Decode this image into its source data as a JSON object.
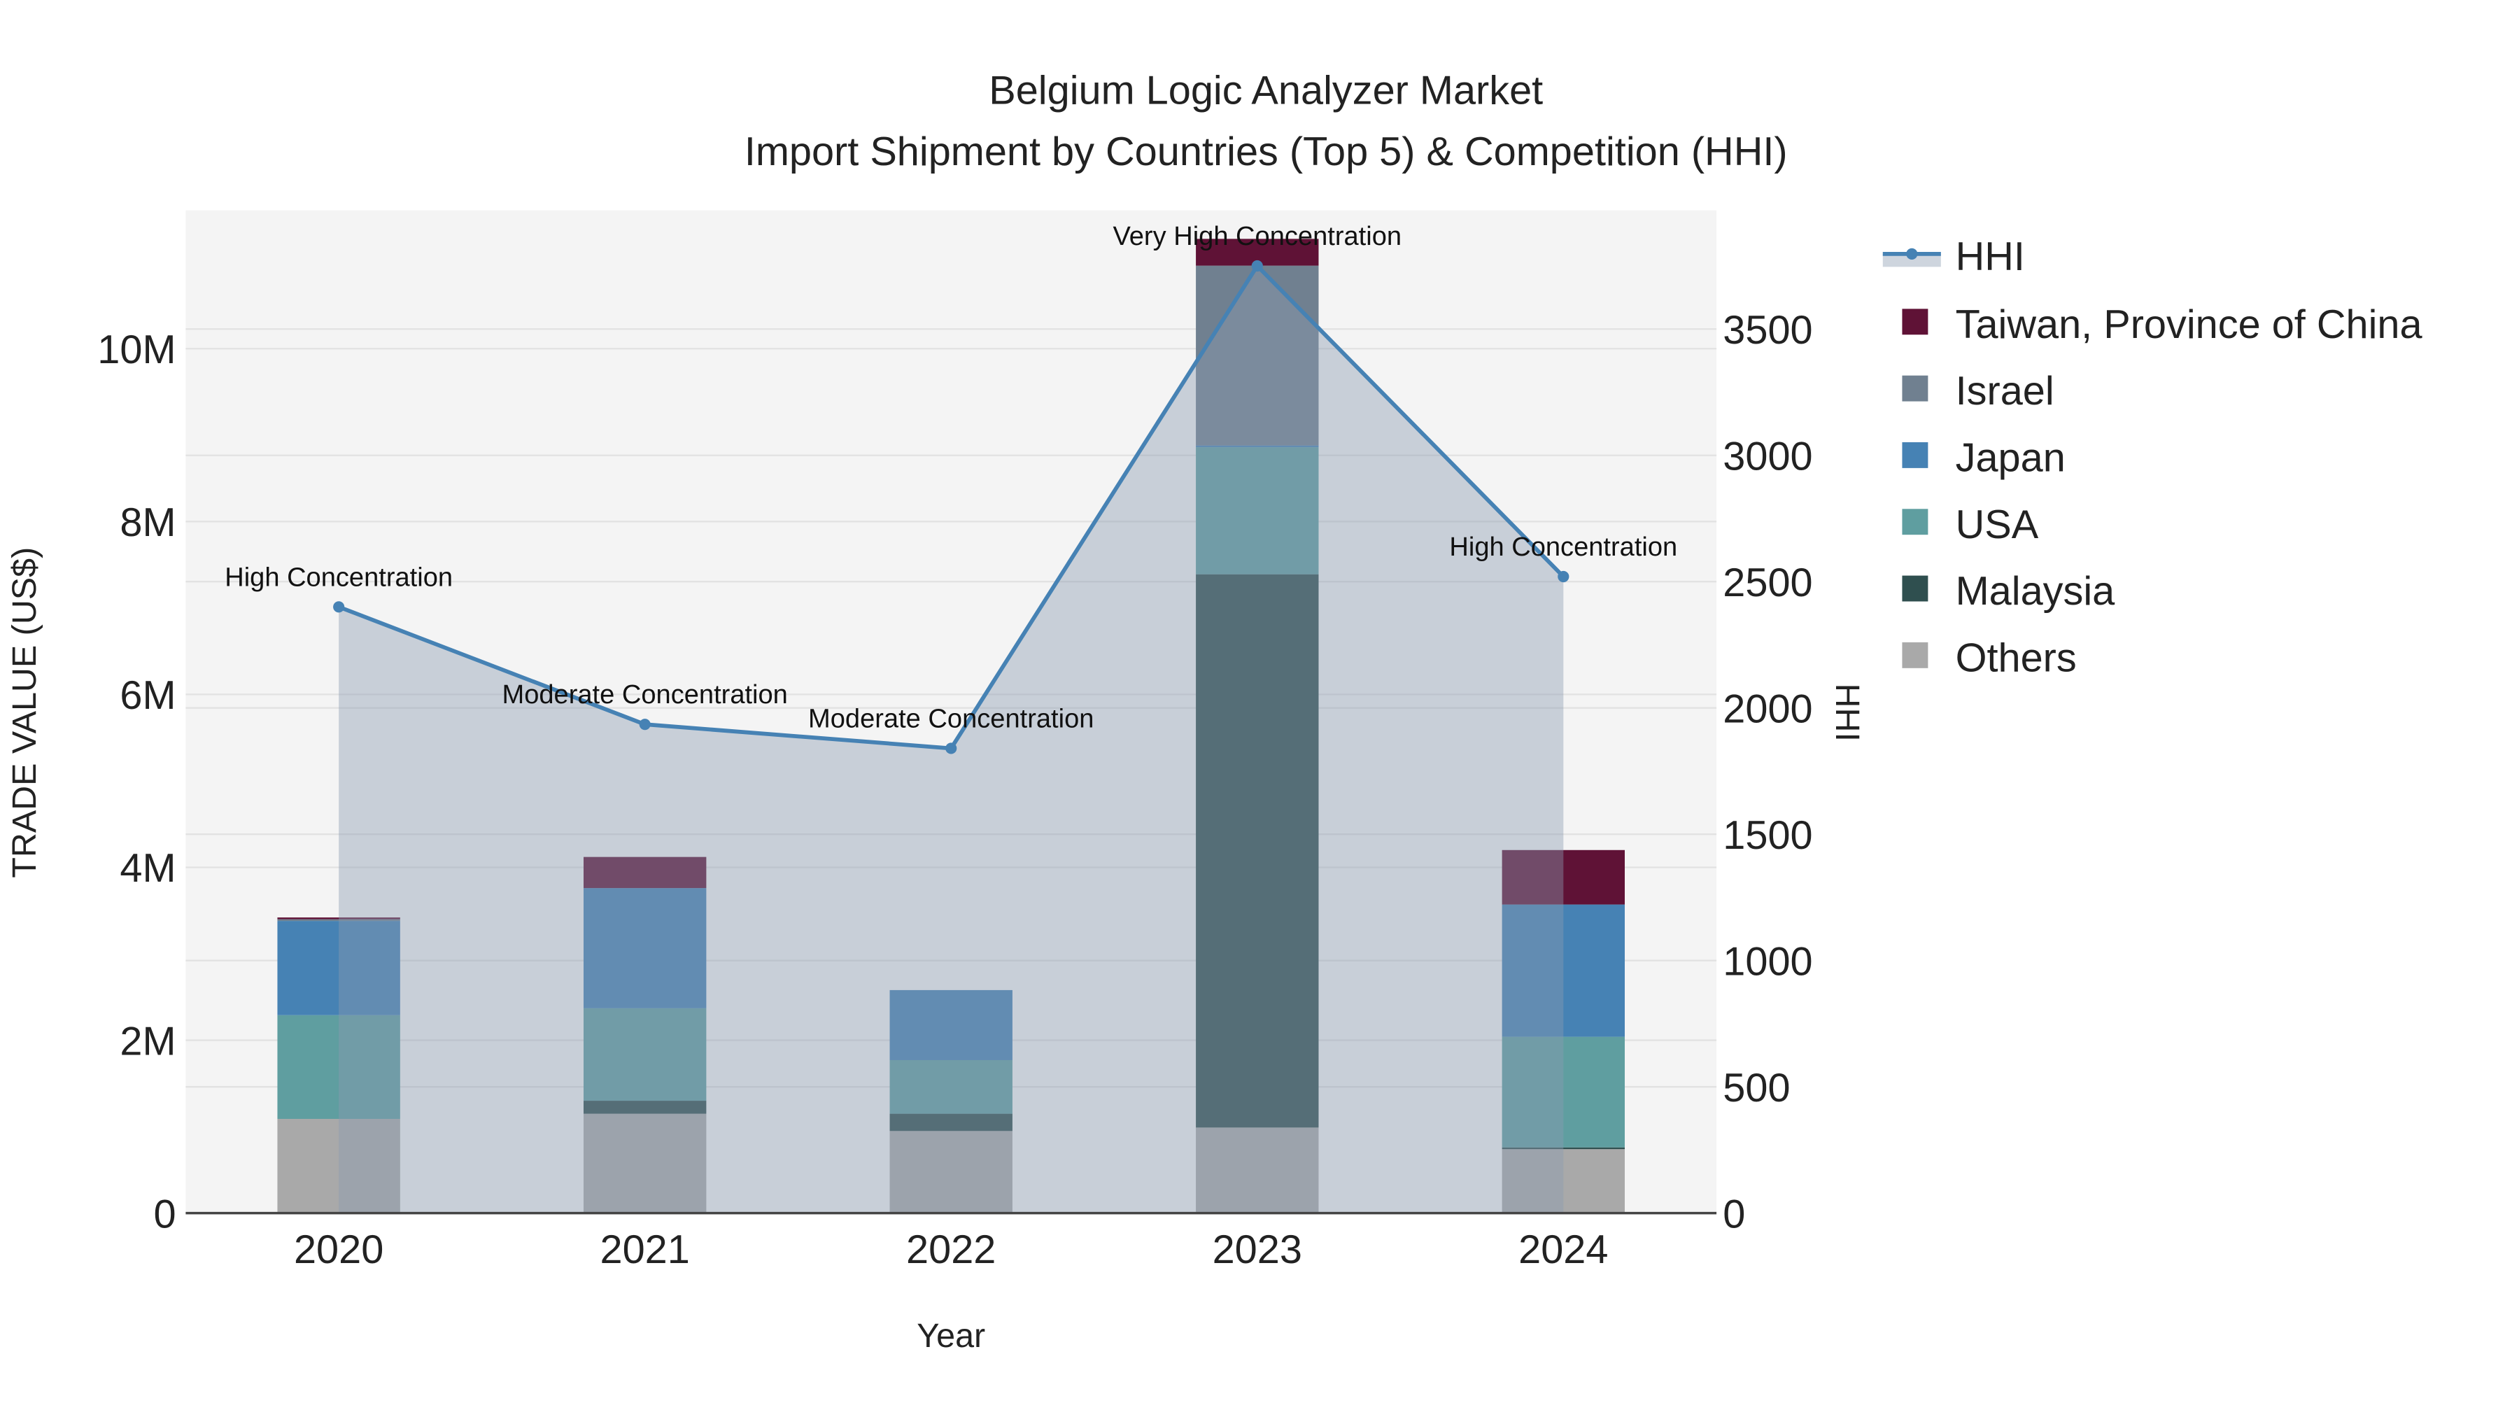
{
  "chart_data": {
    "type": "bar",
    "title": "Belgium Logic Analyzer Market",
    "subtitle": "Import Shipment by Countries (Top 5) & Competition (HHI)",
    "xlabel": "Year",
    "ylabel": "TRADE VALUE (US$)",
    "y2label": "HHI",
    "categories": [
      "2020",
      "2021",
      "2022",
      "2023",
      "2024"
    ],
    "ylim": [
      0,
      11.6
    ],
    "y_unit": "M",
    "y_ticks": [
      0,
      2,
      4,
      6,
      8,
      10
    ],
    "y_tick_labels": [
      "0",
      "2M",
      "4M",
      "6M",
      "8M",
      "10M"
    ],
    "y2lim": [
      0,
      3970
    ],
    "y2_ticks": [
      0,
      500,
      1000,
      1500,
      2000,
      2500,
      3000,
      3500
    ],
    "y2_tick_labels": [
      "0",
      "500",
      "1000",
      "1500",
      "2000",
      "2500",
      "3000",
      "3500"
    ],
    "barmode": "stack",
    "series": [
      {
        "name": "Others",
        "color": "#a9a9a9",
        "values": [
          1.09,
          1.15,
          0.95,
          0.99,
          0.74
        ]
      },
      {
        "name": "Malaysia",
        "color": "#2f4f4f",
        "values": [
          0.0,
          0.15,
          0.2,
          6.4,
          0.02
        ]
      },
      {
        "name": "USA",
        "color": "#5f9ea0",
        "values": [
          1.2,
          1.07,
          0.62,
          1.47,
          1.28
        ]
      },
      {
        "name": "Japan",
        "color": "#4682b4",
        "values": [
          1.09,
          1.39,
          0.81,
          0.02,
          1.53
        ]
      },
      {
        "name": "Israel",
        "color": "#708090",
        "values": [
          0.02,
          0.0,
          0.0,
          2.08,
          0.0
        ]
      },
      {
        "name": "Taiwan, Province of China",
        "color": "#5f1236",
        "values": [
          0.02,
          0.36,
          0.0,
          0.31,
          0.63
        ]
      }
    ],
    "hhi": {
      "name": "HHI",
      "color": "#4682b4",
      "values": [
        2400,
        1935,
        1840,
        3750,
        2520
      ],
      "annotations": [
        "High Concentration",
        "Moderate Concentration",
        "Moderate Concentration",
        "Very High Concentration",
        "High Concentration"
      ]
    },
    "legend_order": [
      "HHI",
      "Taiwan, Province of China",
      "Israel",
      "Japan",
      "USA",
      "Malaysia",
      "Others"
    ],
    "legend_position": "right",
    "grid": true
  }
}
